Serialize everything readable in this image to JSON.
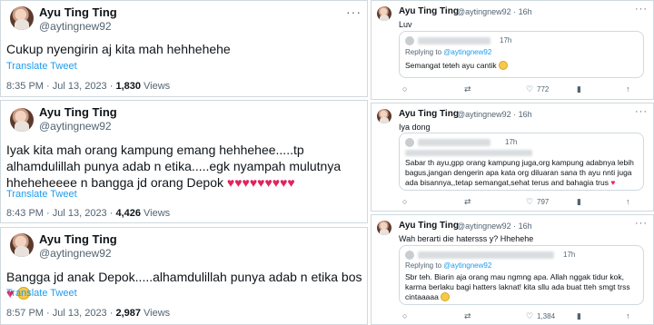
{
  "left": [
    {
      "name": "Ayu Ting Ting",
      "handle": "@aytingnew92",
      "more": "···",
      "text": "Cukup nyengirin aj kita mah hehhehehe",
      "translate": "Translate Tweet",
      "time": "8:35 PM · Jul 13, 2023 · ",
      "views_count": "1,830",
      "views_label": " Views"
    },
    {
      "name": "Ayu Ting Ting",
      "handle": "@aytingnew92",
      "more": "···",
      "text": "Iyak kita mah orang kampung emang hehhehee.....tp alhamdulillah punya adab n etika.....egk nyampah mulutnya hheheheeee n bangga jd orang Depok",
      "hearts": "♥♥♥♥♥♥♥♥♥",
      "translate": "Translate Tweet",
      "time": "8:43 PM · Jul 13, 2023 · ",
      "views_count": "4,426",
      "views_label": " Views"
    },
    {
      "name": "Ayu Ting Ting",
      "handle": "@aytingnew92",
      "more": "···",
      "text": "Bangga jd anak Depok.....alhamdulillah punya adab n etika bos",
      "hearts": "♥",
      "translate": "Translate Tweet",
      "time": "8:57 PM · Jul 13, 2023 · ",
      "views_count": "2,987",
      "views_label": " Views"
    }
  ],
  "right": [
    {
      "name": "Ayu Ting Ting",
      "handle": "@aytingnew92 · 16h",
      "text": "Luv",
      "reply_time": "17h",
      "replying_prefix": "Replying to ",
      "replying_to": "@aytingnew92",
      "reply_text": "Semangat teteh ayu cantik",
      "retweets": "",
      "likes": "772",
      "more": "···"
    },
    {
      "name": "Ayu Ting Ting",
      "handle": "@aytingnew92 · 16h",
      "text": "Iya dong",
      "reply_time": "17h",
      "replying_prefix": "",
      "replying_to": "",
      "reply_text": "Sabar th ayu,gpp orang kampung juga,org kampung adabnya lebih bagus,jangan dengerin apa kata org diluaran sana th ayu nnti juga ada bisannya,,tetap semangat,sehat terus and bahagia trus",
      "retweets": "",
      "likes": "797",
      "more": "···"
    },
    {
      "name": "Ayu Ting Ting",
      "handle": "@aytingnew92 · 16h",
      "text": "Wah berarti die hatersss y? Hhehehe",
      "reply_time": "17h",
      "replying_prefix": "Replying to ",
      "replying_to": "@aytingnew92",
      "reply_text": "Sbr teh. Biarin aja orang mau ngmng apa. Allah nggak tidur kok, karma berlaku bagi hatters laknat! kita sllu ada buat tteh smgt trss cintaaaaa",
      "retweets": "",
      "likes": "1,384",
      "more": "···"
    }
  ],
  "icons": {
    "reply": "○",
    "retweet": "⇄",
    "like": "♡",
    "views": "📊",
    "share": "↑"
  },
  "colors": {
    "link": "#1d9bf0",
    "heart": "#e0245e",
    "muted": "#536471"
  }
}
